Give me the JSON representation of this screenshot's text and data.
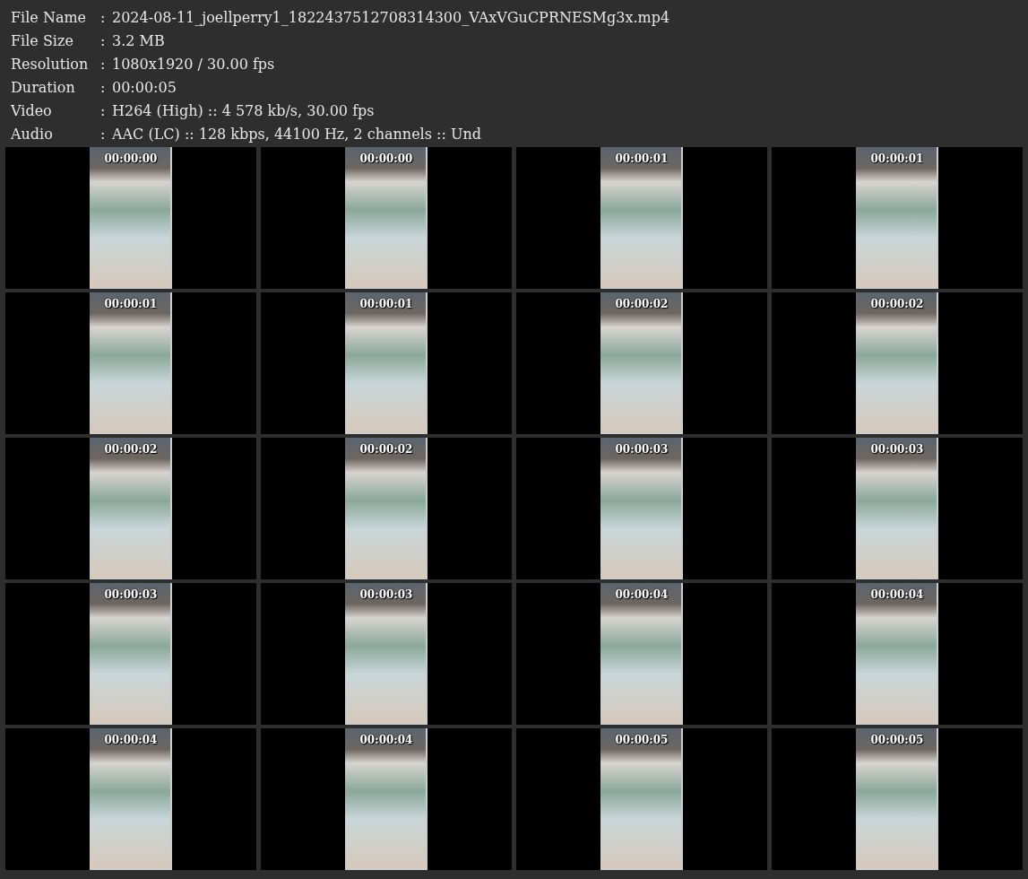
{
  "info": [
    {
      "label": "File Name",
      "value": "2024-08-11_joellperry1_1822437512708314300_VAxVGuCPRNESMg3x.mp4"
    },
    {
      "label": "File Size",
      "value": "3.2 MB"
    },
    {
      "label": "Resolution",
      "value": "1080x1920 / 30.00 fps"
    },
    {
      "label": "Duration",
      "value": "00:00:05"
    },
    {
      "label": "Video",
      "value": "H264 (High) :: 4 578 kb/s, 30.00 fps"
    },
    {
      "label": "Audio",
      "value": "AAC (LC) :: 128 kbps, 44100 Hz, 2 channels :: Und"
    }
  ],
  "separator": ":",
  "frames": [
    "00:00:00",
    "00:00:00",
    "00:00:01",
    "00:00:01",
    "00:00:01",
    "00:00:01",
    "00:00:02",
    "00:00:02",
    "00:00:02",
    "00:00:02",
    "00:00:03",
    "00:00:03",
    "00:00:03",
    "00:00:03",
    "00:00:04",
    "00:00:04",
    "00:00:04",
    "00:00:04",
    "00:00:05",
    "00:00:05"
  ]
}
